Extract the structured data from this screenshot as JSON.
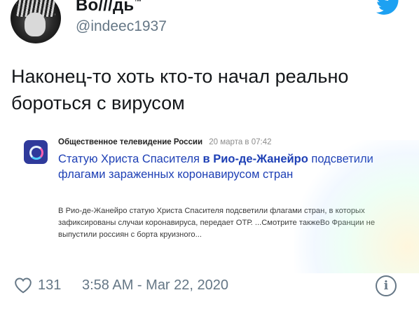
{
  "author": {
    "display_name": "Во///дь",
    "name_suffix": "™",
    "handle": "@indeec1937",
    "avatar_icon": "avatar-portrait"
  },
  "tweet": {
    "text": "Наконец-то хоть кто-то начал реально бороться с вирусом"
  },
  "news_card": {
    "source": "Общественное телевидение России",
    "date": "20 марта в 07:42",
    "headline_part1": "Статую Христа Спасителя ",
    "headline_part2": "в Рио-де-Жанейро",
    "headline_part3": " подсветили флагами зараженных коронавирусом стран",
    "snippet": "В Рио-де-Жанейро статую Христа Спасителя подсветили флагами стран, в которых зафиксированы случаи коронавируса, передает ОТР. ...Смотрите такжеВо Франции не выпустили россиян с борта круизного..."
  },
  "footer": {
    "like_count": "131",
    "timestamp": "3:58 AM - Mar 22, 2020",
    "info_symbol": "i"
  },
  "colors": {
    "accent": "#1da1f2",
    "secondary_text": "#657786",
    "headline_link": "#1d3fb5"
  }
}
